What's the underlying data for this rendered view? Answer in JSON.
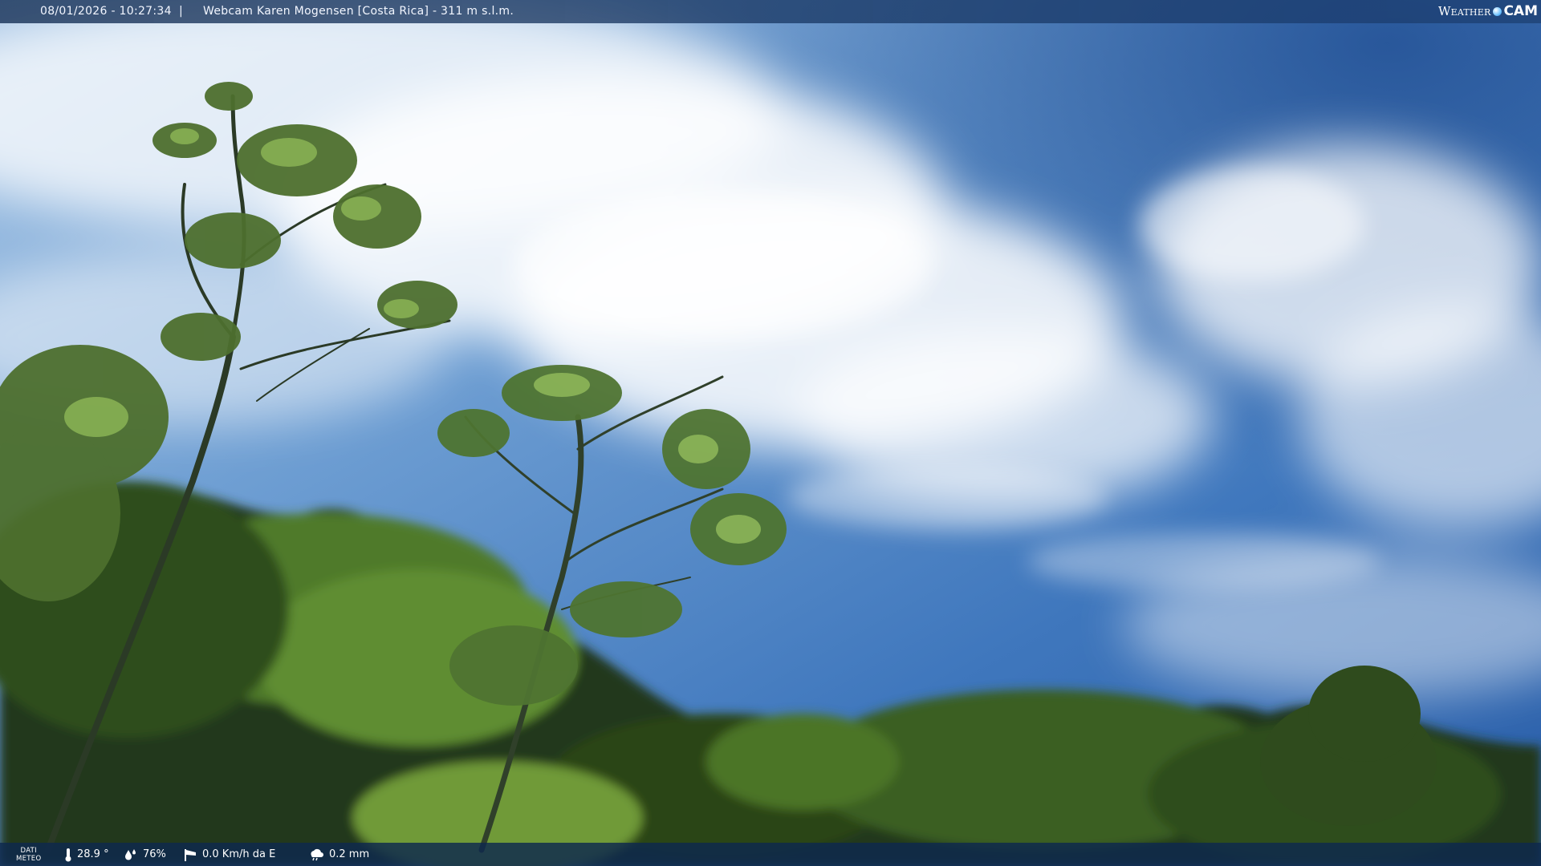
{
  "header": {
    "datetime": "08/01/2026 - 10:27:34",
    "separator": "|",
    "title": "Webcam Karen Mogensen [Costa Rica] - 311 m s.l.m."
  },
  "logo": {
    "part1": "Weather",
    "part2": "CAM",
    "icon": "globe-dot-icon"
  },
  "weather": {
    "label_line1": "DATI",
    "label_line2": "METEO",
    "temperature": "28.9 °",
    "humidity": "76%",
    "wind": "0.0 Km/h da E",
    "rain": "0.2 mm",
    "icons": [
      "thermometer-icon",
      "humidity-drop-icon",
      "wind-sock-icon",
      "rain-cloud-icon"
    ]
  },
  "colors": {
    "sky_deep": "#2a5ea8",
    "sky_mid": "#4f87c4",
    "cloud": "#ffffff",
    "foliage_dark": "#1e3414",
    "foliage_light": "#6f9a3a",
    "bar": "#0e284e"
  }
}
